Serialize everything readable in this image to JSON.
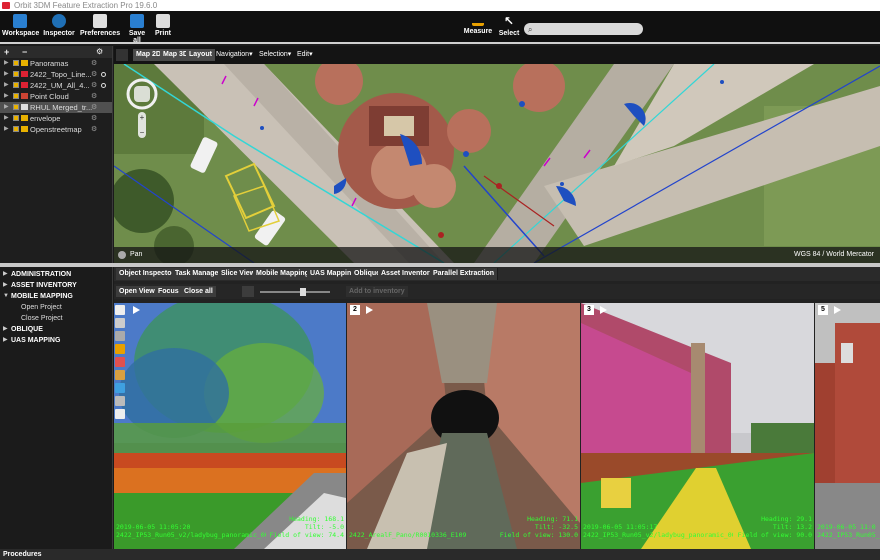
{
  "window": {
    "title": "Orbit 3DM Feature Extraction Pro 19.6.0"
  },
  "toolbar": {
    "buttons": [
      "Workspace",
      "Inspector",
      "Preferences",
      "Save all",
      "Print"
    ],
    "right_buttons": [
      "Measure",
      "Select"
    ],
    "search_placeholder": ""
  },
  "layers": {
    "header_add": "+",
    "header_remove": "−",
    "items": [
      {
        "label": "Panoramas",
        "color": "#e8b100"
      },
      {
        "label": "2422_Topo_Line...",
        "color": "#d23"
      },
      {
        "label": "2422_UM_All_4...",
        "color": "#d23"
      },
      {
        "label": "Point Cloud",
        "color": "#c43"
      },
      {
        "label": "RHUL Merged_tr...",
        "color": "#ddd"
      },
      {
        "label": "envelope",
        "color": "#e8b100"
      },
      {
        "label": "Openstreetmap",
        "color": "#e8b100"
      }
    ]
  },
  "map": {
    "tabs": [
      "Map 2D",
      "Map 3D",
      "Layout"
    ],
    "menus": [
      "Navigation",
      "Selection",
      "Edit"
    ],
    "status_tool": "Pan",
    "crs": "WGS 84 / World Mercator"
  },
  "menu": {
    "sections": [
      {
        "label": "ADMINISTRATION",
        "open": false
      },
      {
        "label": "ASSET INVENTORY",
        "open": false
      },
      {
        "label": "MOBILE MAPPING",
        "open": true,
        "items": [
          "Open Project",
          "Close Project"
        ]
      },
      {
        "label": "OBLIQUE",
        "open": false
      },
      {
        "label": "UAS MAPPING",
        "open": false
      }
    ]
  },
  "subtabs": [
    "Object Inspector",
    "Task Manager",
    "Slice View",
    "Mobile Mapping",
    "UAS Mapping",
    "Oblique",
    "Asset Inventory",
    "Parallel Extraction"
  ],
  "actions": {
    "open_view": "Open View",
    "focus": "Focus",
    "close_all": "Close all",
    "add_inventory": "Add to inventory"
  },
  "panos": [
    {
      "num": "1",
      "date": "2019-06-05 11:05:20",
      "file": "2422_IP53_Run05_v2/ladybug_panoramic_000153",
      "heading_label": "Heading:",
      "heading": "168.1",
      "tilt_label": "Tilt:",
      "tilt": "-5.0",
      "fov_label": "Field of view:",
      "fov": "74.4"
    },
    {
      "num": "2",
      "date": "",
      "file": "2422_ArealF_Pano/R0010336_E109",
      "heading_label": "Heading:",
      "heading": "71.1",
      "tilt_label": "Tilt:",
      "tilt": "-32.5",
      "fov_label": "Field of view:",
      "fov": "130.0"
    },
    {
      "num": "3",
      "date": "2019-06-05 11:05:17",
      "file": "2422_IP53_Run05_v2/ladybug_panoramic_000152",
      "heading_label": "Heading:",
      "heading": "29.1",
      "tilt_label": "Tilt:",
      "tilt": "13.2",
      "fov_label": "Field of view:",
      "fov": "90.0"
    },
    {
      "num": "5",
      "date": "2019-06-05 11:0",
      "file": "2422_IP53_Run05_",
      "heading_label": "",
      "heading": "",
      "tilt_label": "",
      "tilt": "",
      "fov_label": "",
      "fov": ""
    }
  ],
  "statusbar": {
    "label": "Procedures"
  },
  "colors": {
    "accent": "#1f6fb5",
    "map_green": "#6d8a4c",
    "hud_green": "#33ff33"
  }
}
